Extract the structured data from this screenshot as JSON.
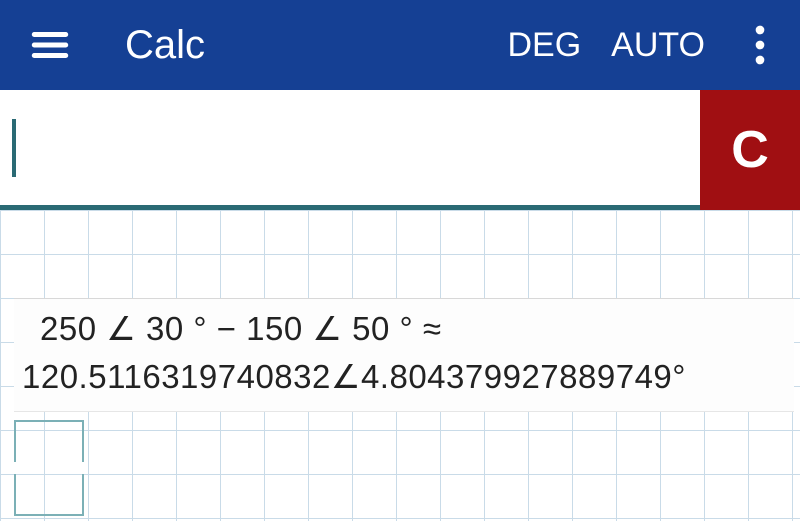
{
  "appbar": {
    "title": "Calc",
    "angle_mode": "DEG",
    "format_mode": "AUTO"
  },
  "input": {
    "value": "",
    "clear_label": "C"
  },
  "history": {
    "expression": "250 ∠ 30 °  −  150 ∠ 50 °   ≈",
    "result": "120.5116319740832∠4.804379927889749°"
  },
  "icons": {
    "menu": "menu-icon",
    "overflow": "more-vert-icon"
  },
  "colors": {
    "primary": "#154094",
    "danger": "#a00f12",
    "underline": "#2a6a74"
  }
}
